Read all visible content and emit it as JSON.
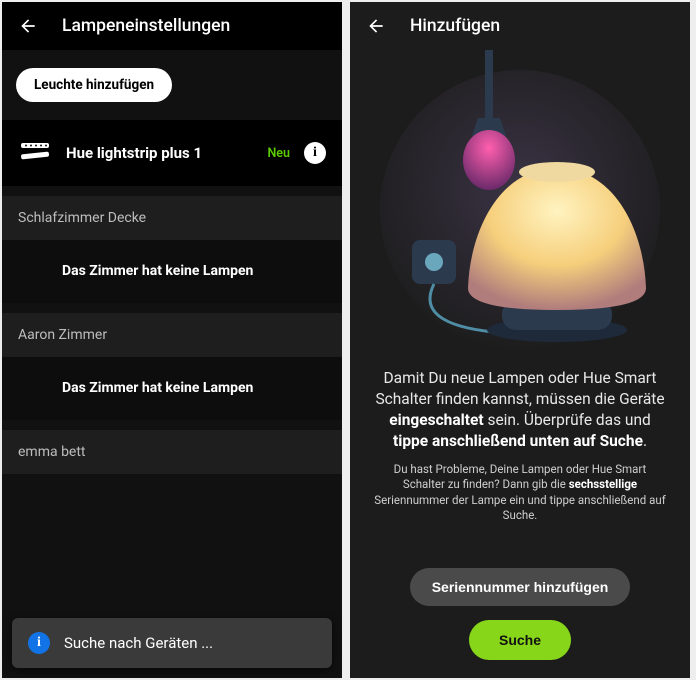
{
  "left": {
    "header_title": "Lampeneinstellungen",
    "add_light_label": "Leuchte hinzufügen",
    "new_light": {
      "name": "Hue lightstrip plus 1",
      "badge": "Neu"
    },
    "rooms": [
      {
        "name": "Schlafzimmer Decke",
        "empty_msg": "Das Zimmer hat keine Lampen"
      },
      {
        "name": "Aaron Zimmer",
        "empty_msg": "Das Zimmer hat keine Lampen"
      },
      {
        "name": "emma bett",
        "empty_msg": ""
      }
    ],
    "toast": "Suche nach Geräten ..."
  },
  "right": {
    "header_title": "Hinzufügen",
    "instructions": {
      "pre1": "Damit Du neue Lampen oder Hue Smart Schalter finden kannst, müssen die Geräte ",
      "bold1": "eingeschaltet",
      "mid1": " sein. Überprüfe das und ",
      "bold2": "tippe anschließend unten auf Suche",
      "post1": ".",
      "sub_pre": "Du hast Probleme, Deine Lampen oder Hue Smart Schalter zu finden? Dann gib die ",
      "sub_bold": "sechsstellige",
      "sub_post": " Seriennummer der Lampe ein und tippe anschließend auf Suche."
    },
    "serial_button": "Seriennummer hinzufügen",
    "search_button": "Suche"
  }
}
